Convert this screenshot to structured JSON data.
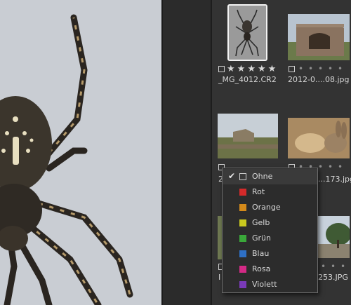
{
  "preview": {
    "subject": "spider-photo"
  },
  "thumbnails": [
    {
      "filename": "_MG_4012.CR2",
      "rating": "stars",
      "selected": true
    },
    {
      "filename": "2012-0....08.jpg",
      "rating": "dots",
      "selected": false
    },
    {
      "filename": "2",
      "rating": "dots",
      "selected": false
    },
    {
      "filename": "...173.jpg",
      "rating": "dots",
      "selected": false
    },
    {
      "filename": "I",
      "rating": "dots",
      "selected": false
    },
    {
      "filename": "253.JPG",
      "rating": "dots",
      "selected": false
    }
  ],
  "color_menu": {
    "items": [
      {
        "label": "Ohne",
        "color": "",
        "checked": true
      },
      {
        "label": "Rot",
        "color": "#d42a2a"
      },
      {
        "label": "Orange",
        "color": "#d48a1a"
      },
      {
        "label": "Gelb",
        "color": "#c8c81e"
      },
      {
        "label": "Grün",
        "color": "#3aa83a"
      },
      {
        "label": "Blau",
        "color": "#2e6fc4"
      },
      {
        "label": "Rosa",
        "color": "#d42a86"
      },
      {
        "label": "Violett",
        "color": "#7a3ab8"
      }
    ]
  }
}
